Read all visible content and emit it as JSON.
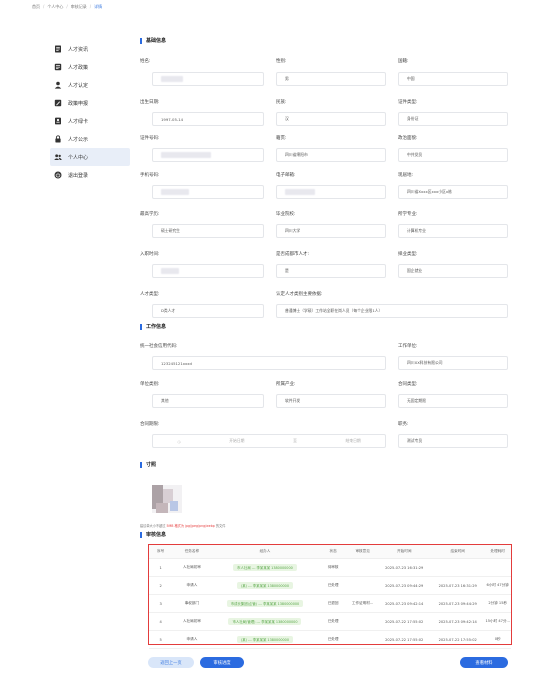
{
  "breadcrumb": {
    "items": [
      "首页",
      "个人中心",
      "审核记录"
    ],
    "current": "详情"
  },
  "sidebar": {
    "items": [
      {
        "label": "人才资讯",
        "icon": "document-icon",
        "active": false
      },
      {
        "label": "人才政策",
        "icon": "policy-icon",
        "active": false
      },
      {
        "label": "人才认定",
        "icon": "user-icon",
        "active": false
      },
      {
        "label": "政策申报",
        "icon": "edit-icon",
        "active": false
      },
      {
        "label": "人才绿卡",
        "icon": "card-icon",
        "active": false
      },
      {
        "label": "人才公示",
        "icon": "lock-icon",
        "active": false
      },
      {
        "label": "个人中心",
        "icon": "users-icon",
        "active": true
      },
      {
        "label": "退出登录",
        "icon": "logout-icon",
        "active": false
      }
    ]
  },
  "basic": {
    "title": "基础信息",
    "fields": [
      {
        "label": "姓名:",
        "value": ""
      },
      {
        "label": "性别:",
        "value": "男"
      },
      {
        "label": "国籍:",
        "value": "中国"
      },
      {
        "label": "出生日期:",
        "value": "1997-05-14"
      },
      {
        "label": "民族:",
        "value": "汉"
      },
      {
        "label": "证件类型:",
        "value": "身份证"
      },
      {
        "label": "证件号码:",
        "value": ""
      },
      {
        "label": "籍贯:",
        "value": "四川省绵阳市"
      },
      {
        "label": "政治面貌:",
        "value": "中共党员"
      },
      {
        "label": "手机号码:",
        "value": ""
      },
      {
        "label": "电子邮箱:",
        "value": ""
      },
      {
        "label": "现居地:",
        "value": "四川省Xxxx区xxx小区x栋"
      },
      {
        "label": "最高学历:",
        "value": "硕士研究生"
      },
      {
        "label": "毕业院校:",
        "value": "四川大学"
      },
      {
        "label": "所学专业:",
        "value": "计算机专业"
      },
      {
        "label": "入职时间:",
        "value": ""
      },
      {
        "label": "是否成都市人才:",
        "value": "是"
      },
      {
        "label": "择业类型:",
        "value": "国企就业"
      },
      {
        "label": "人才类型:",
        "value": "D类人才"
      },
      {
        "label": "认定人才类别主要依据:",
        "value": "普通博士（学硕）工作站全职在岗人员（每个企业限1人）"
      }
    ]
  },
  "work": {
    "title": "工作信息",
    "fields": [
      {
        "label": "统一社会信用代码:",
        "value": "123245121xxxd"
      },
      {
        "label": "工作单位:",
        "value": "四川XX科技有限公司"
      },
      {
        "label": "单位类别:",
        "value": "其他"
      },
      {
        "label": "所属产业:",
        "value": "软件开发"
      },
      {
        "label": "合同类型:",
        "value": "无固定期限"
      },
      {
        "label": "合同期限:",
        "value": ""
      },
      {
        "label": "职务:",
        "value": "测试专员"
      }
    ],
    "contract_start_placeholder": "开始日期",
    "contract_sep": "至",
    "contract_end_placeholder": "结束日期"
  },
  "photo": {
    "title": "寸照",
    "hint_prefix": "建议单大小不超过",
    "hint_red": "5MB 格式为 jpg/jpeg/png/webp",
    "hint_suffix": "的文件"
  },
  "review": {
    "title": "审核信息",
    "columns": [
      "序号",
      "任务名称",
      "经办人",
      "状态",
      "审核意见",
      "开始时间",
      "结束时间",
      "处理耗时"
    ],
    "rows": [
      {
        "no": "1",
        "task": "人社局初审",
        "handler": "市人社局 --- 李某某某 1380000000",
        "status": "待审核",
        "opinion": "",
        "start": "2025-07-23 16:31:29",
        "end": "",
        "duration": ""
      },
      {
        "no": "2",
        "task": "申请人",
        "handler": "(某) --- 李某某某 1380000000",
        "status": "已处理",
        "opinion": "",
        "start": "2025-07-23 09:44:29",
        "end": "2025-07-23 16:31:29",
        "duration": "6小时 47分钟"
      },
      {
        "no": "3",
        "task": "事权部门",
        "handler": "市成长集团(企管) --- 李某某某 1380000000",
        "status": "已退回",
        "opinion": "工作证明材...",
        "start": "2025-07-23 09:42:14",
        "end": "2025-07-23 09:44:29",
        "duration": "2分钟 15秒"
      },
      {
        "no": "4",
        "task": "人社局初审",
        "handler": "市人社局(管理) --- 李某某某 1380000000",
        "status": "已处理",
        "opinion": "",
        "start": "2025-07-22 17:55:02",
        "end": "2025-07-23 09:42:14",
        "duration": "15小时 47分..."
      },
      {
        "no": "5",
        "task": "申请人",
        "handler": "(某) --- 李某某某 1380000000",
        "status": "已处理",
        "opinion": "",
        "start": "2025-07-22 17:55:02",
        "end": "2025-07-22 17:55:02",
        "duration": "0秒"
      }
    ]
  },
  "buttons": {
    "back": "返回上一页",
    "progress": "审核进度",
    "materials": "查看材料"
  },
  "colors": {
    "accent": "#2b6be0",
    "highlight_border": "#e33c3c",
    "pill_bg": "#e8f5e2"
  }
}
